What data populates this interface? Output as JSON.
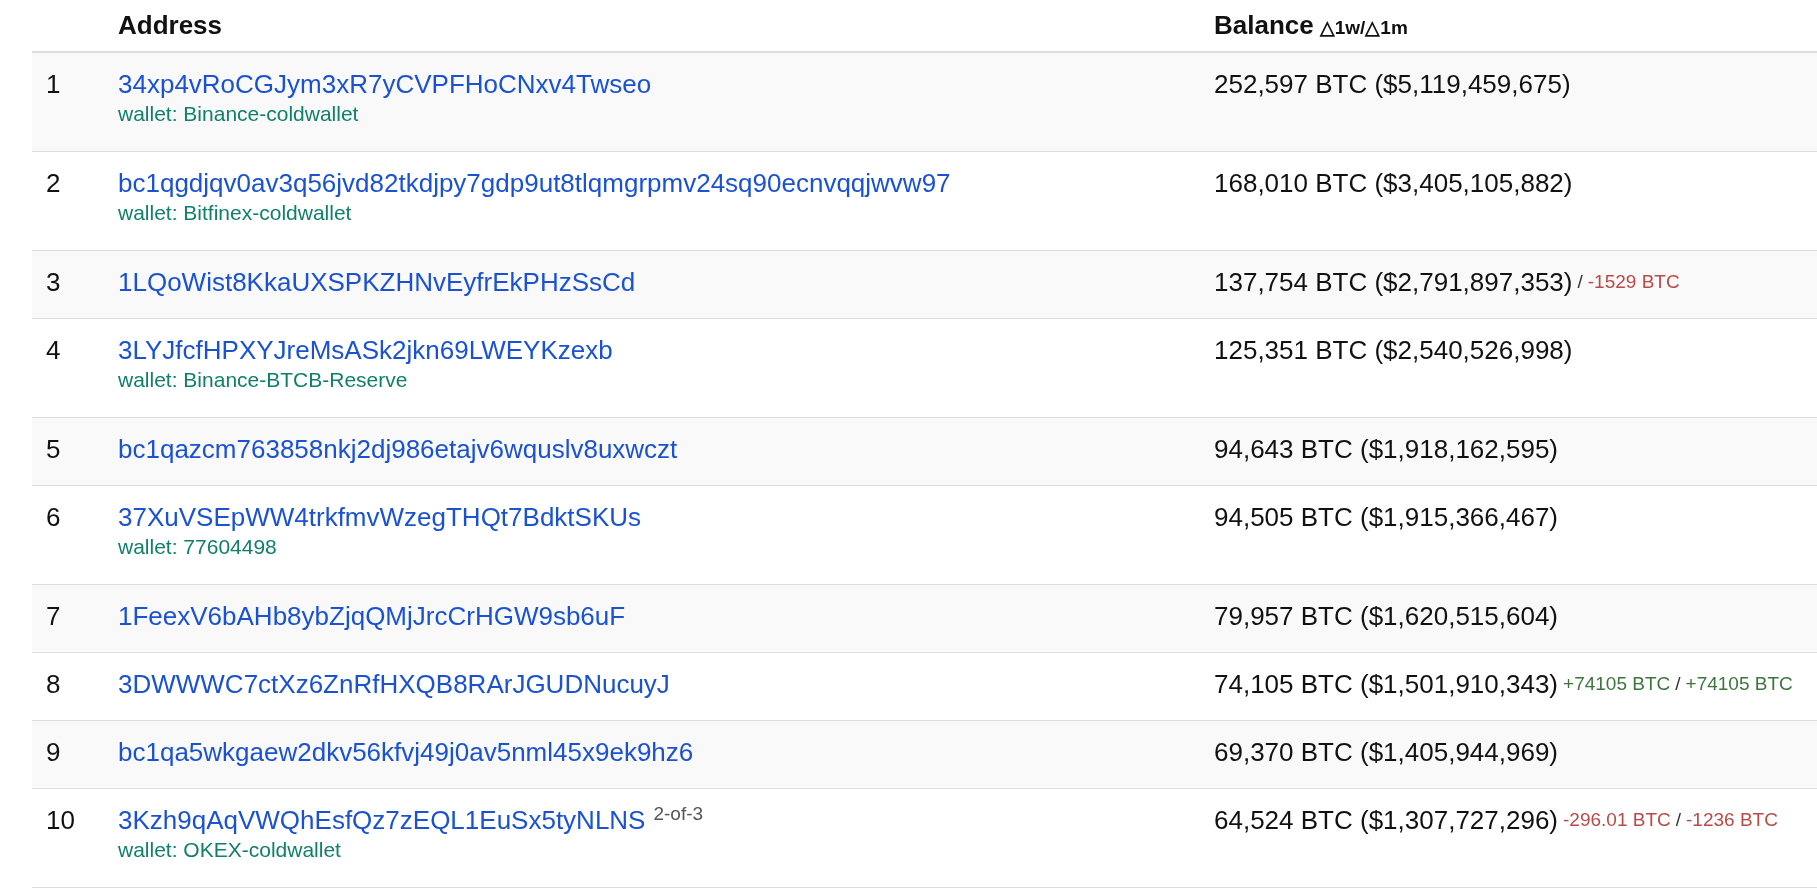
{
  "table": {
    "columns": [
      {
        "label": "Address"
      },
      {
        "label": "Balance",
        "suffix": "△1w/△1m"
      }
    ],
    "rows": [
      {
        "rank": "1",
        "address": "34xp4vRoCGJym3xR7yCVPFHoCNxv4Twseo",
        "wallet": "wallet: Binance-coldwallet",
        "balance": "252,597 BTC ($5,119,459,675)"
      },
      {
        "rank": "2",
        "address": "bc1qgdjqv0av3q56jvd82tkdjpy7gdp9ut8tlqmgrpmv24sq90ecnvqqjwvw97",
        "wallet": "wallet: Bitfinex-coldwallet",
        "balance": "168,010 BTC ($3,405,105,882)"
      },
      {
        "rank": "3",
        "address": "1LQoWist8KkaUXSPKZHNvEyfrEkPHzSsCd",
        "balance": "137,754 BTC ($2,791,897,353)",
        "changes": [
          {
            "kind": "separator",
            "text": "/"
          },
          {
            "kind": "delta",
            "text": "-1529 BTC",
            "color": "#b94a48"
          }
        ]
      },
      {
        "rank": "4",
        "address": "3LYJfcfHPXYJreMsASk2jkn69LWEYKzexb",
        "wallet": "wallet: Binance-BTCB-Reserve",
        "balance": "125,351 BTC ($2,540,526,998)"
      },
      {
        "rank": "5",
        "address": "bc1qazcm763858nkj2dj986etajv6wquslv8uxwczt",
        "balance": "94,643 BTC ($1,918,162,595)"
      },
      {
        "rank": "6",
        "address": "37XuVSEpWW4trkfmvWzegTHQt7BdktSKUs",
        "wallet": "wallet: 77604498",
        "balance": "94,505 BTC ($1,915,366,467)"
      },
      {
        "rank": "7",
        "address": "1FeexV6bAHb8ybZjqQMjJrcCrHGW9sb6uF",
        "balance": "79,957 BTC ($1,620,515,604)"
      },
      {
        "rank": "8",
        "address": "3DWWWC7ctXz6ZnRfHXQB8RArJGUDNucuyJ",
        "balance": "74,105 BTC ($1,501,910,343)",
        "changes": [
          {
            "kind": "delta",
            "text": "+74105 BTC",
            "color": "#3c763d"
          },
          {
            "kind": "separator",
            "text": "/"
          },
          {
            "kind": "delta",
            "text": "+74105 BTC",
            "color": "#3c763d"
          }
        ]
      },
      {
        "rank": "9",
        "address": "bc1qa5wkgaew2dkv56kfvj49j0av5nml45x9ek9hz6",
        "balance": "69,370 BTC ($1,405,944,969)"
      },
      {
        "rank": "10",
        "address": "3Kzh9qAqVWQhEsfQz7zEQL1EuSx5tyNLNS",
        "multisig": "2-of-3",
        "wallet": "wallet: OKEX-coldwallet",
        "balance": "64,524 BTC ($1,307,727,296)",
        "changes": [
          {
            "kind": "delta",
            "text": "-296.01 BTC",
            "color": "#b94a48"
          },
          {
            "kind": "separator",
            "text": "/"
          },
          {
            "kind": "delta",
            "text": "-1236 BTC",
            "color": "#b94a48"
          }
        ]
      }
    ]
  }
}
